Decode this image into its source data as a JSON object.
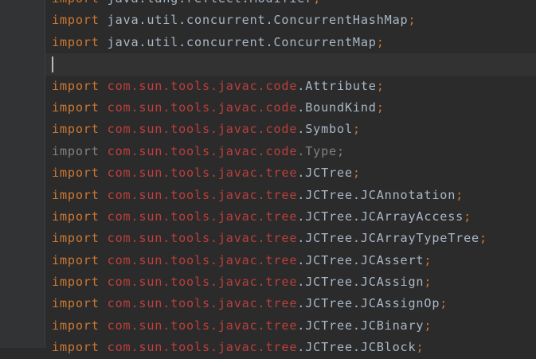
{
  "colors": {
    "keyword": "#cc7832",
    "unresolved": "#bc3f3c",
    "identifier": "#a9b7c6",
    "unused": "#808080",
    "gutter": "#313335",
    "background": "#2b2b2b"
  },
  "editor": {
    "lines": [
      {
        "kw": "import",
        "pkg": "java.lang.reflect.",
        "id": "Modifier",
        "semi": ";",
        "style": "normal"
      },
      {
        "kw": "import",
        "pkg": "java.util.concurrent.",
        "id": "ConcurrentHashMap",
        "semi": ";",
        "style": "normal"
      },
      {
        "kw": "import",
        "pkg": "java.util.concurrent.",
        "id": "ConcurrentMap",
        "semi": ";",
        "style": "normal"
      },
      {
        "kw": "",
        "pkg": "",
        "id": "",
        "semi": "",
        "style": "caret"
      },
      {
        "kw": "import",
        "pkg": "com.sun.tools.javac.code",
        "id": ".Attribute",
        "semi": ";",
        "style": "error"
      },
      {
        "kw": "import",
        "pkg": "com.sun.tools.javac.code",
        "id": ".BoundKind",
        "semi": ";",
        "style": "error"
      },
      {
        "kw": "import",
        "pkg": "com.sun.tools.javac.code",
        "id": ".Symbol",
        "semi": ";",
        "style": "error"
      },
      {
        "kw": "import",
        "pkg": "com.sun.tools.javac.code",
        "id": ".Type",
        "semi": ";",
        "style": "unused"
      },
      {
        "kw": "import",
        "pkg": "com.sun.tools.javac.tree",
        "id": ".JCTree",
        "semi": ";",
        "style": "error"
      },
      {
        "kw": "import",
        "pkg": "com.sun.tools.javac.tree",
        "id": ".JCTree.JCAnnotation",
        "semi": ";",
        "style": "error"
      },
      {
        "kw": "import",
        "pkg": "com.sun.tools.javac.tree",
        "id": ".JCTree.JCArrayAccess",
        "semi": ";",
        "style": "error"
      },
      {
        "kw": "import",
        "pkg": "com.sun.tools.javac.tree",
        "id": ".JCTree.JCArrayTypeTree",
        "semi": ";",
        "style": "error"
      },
      {
        "kw": "import",
        "pkg": "com.sun.tools.javac.tree",
        "id": ".JCTree.JCAssert",
        "semi": ";",
        "style": "error"
      },
      {
        "kw": "import",
        "pkg": "com.sun.tools.javac.tree",
        "id": ".JCTree.JCAssign",
        "semi": ";",
        "style": "error"
      },
      {
        "kw": "import",
        "pkg": "com.sun.tools.javac.tree",
        "id": ".JCTree.JCAssignOp",
        "semi": ";",
        "style": "error"
      },
      {
        "kw": "import",
        "pkg": "com.sun.tools.javac.tree",
        "id": ".JCTree.JCBinary",
        "semi": ";",
        "style": "error"
      },
      {
        "kw": "import",
        "pkg": "com.sun.tools.javac.tree",
        "id": ".JCTree.JCBlock",
        "semi": ";",
        "style": "error"
      }
    ]
  }
}
